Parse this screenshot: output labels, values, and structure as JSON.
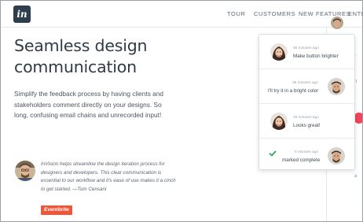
{
  "nav": {
    "logo_text": "in",
    "links": [
      "TOUR",
      "CUSTOMERS",
      "NEW FEATURES",
      "ENTE"
    ]
  },
  "hero": {
    "title": "Seamless design communication",
    "body": "Simplify the feedback process by having clients and stakeholders comment directly on your designs. So long, confusing email chains and unrecorded input!"
  },
  "testimonial": {
    "quote": "InVision helps streamline the design iteration process for designers and developers. This clear communication is essential to our workflow and it's ease of use makes it a cinch to get started. —Tom Censani",
    "brand": "Eventbrite"
  },
  "comments": [
    {
      "time": "55 minutes ago",
      "text": "Make button brighter",
      "side": "left"
    },
    {
      "time": "36 minutes ago",
      "text": "I'll try it in a bright color",
      "side": "right"
    },
    {
      "time": "18 minutes ago",
      "text": "Looks great!",
      "side": "left"
    },
    {
      "time": "5 minutes ago",
      "text": "marked complete",
      "side": "right",
      "icon": "check-icon"
    }
  ],
  "colors": {
    "logo_bg": "#2e3e4e",
    "brand_badge": "#f05537",
    "check_green": "#3aa35a",
    "notification_red": "#f0455a"
  }
}
